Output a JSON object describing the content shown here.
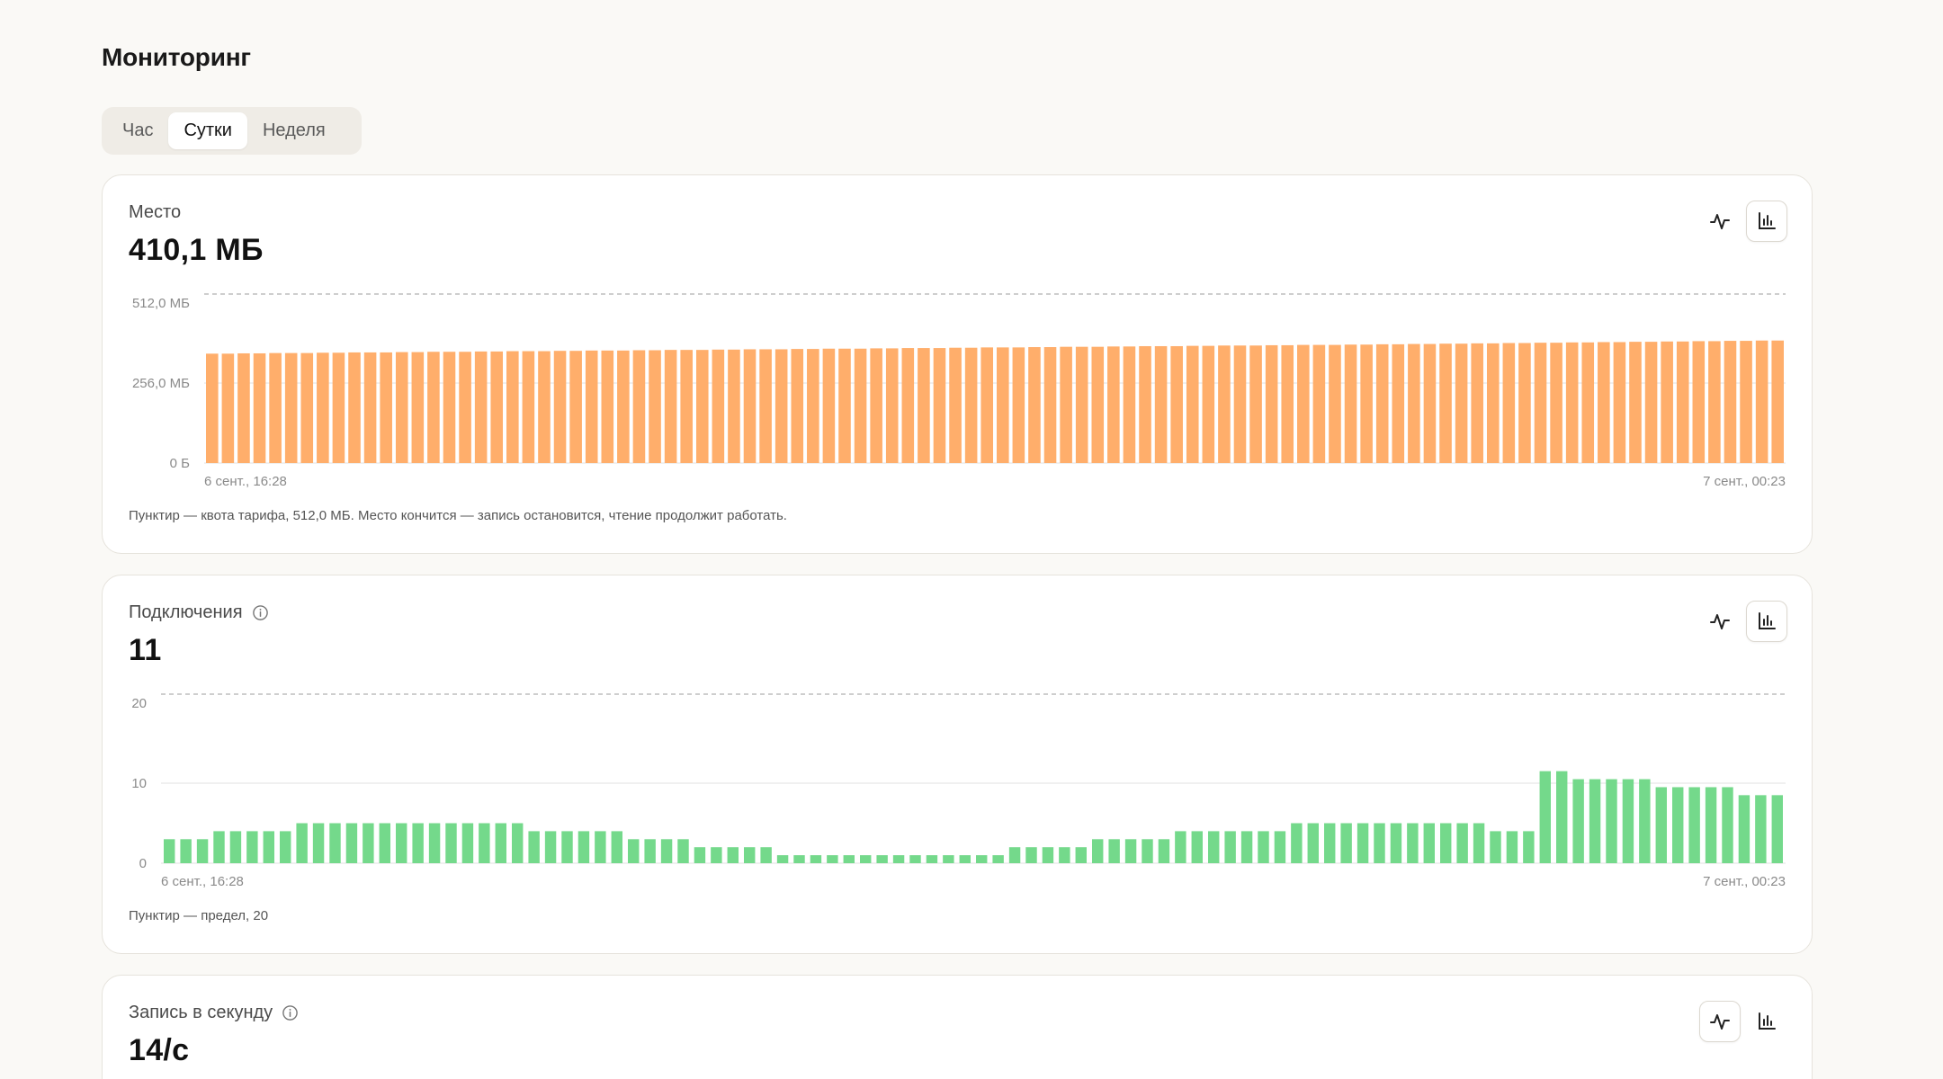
{
  "page": {
    "title": "Мониторинг",
    "periods": [
      "Час",
      "Сутки",
      "Неделя"
    ],
    "active_period": "Сутки"
  },
  "icons": {
    "line_chart": "line-chart-icon",
    "bar_chart": "bar-chart-icon",
    "info": "info-icon"
  },
  "colors": {
    "storage_bar": "#ffae6b",
    "connections_bar": "#74d98b",
    "quota_line": "#bdbdbd"
  },
  "cards": {
    "storage": {
      "label": "Место",
      "value": "410,1 МБ",
      "note": "Пунктир — квота тарифа, 512,0 МБ. Место кончится — запись остановится, чтение продолжит работать.",
      "active_view": "bar"
    },
    "connections": {
      "label": "Подключения",
      "value": "11",
      "note": "Пунктир — предел, 20",
      "active_view": "bar"
    },
    "writes": {
      "label": "Запись в секунду",
      "value": "14/с",
      "active_view": "line"
    }
  },
  "chart_data": [
    {
      "type": "bar",
      "name": "storage",
      "y_ticks": [
        "512,0 МБ",
        "256,0 МБ",
        "0 Б"
      ],
      "x_start_label": "6 сент., 16:28",
      "x_end_label": "7 сент., 00:23",
      "ylim": [
        0,
        512
      ],
      "quota": 512,
      "grid": true,
      "values": [
        350,
        350,
        351,
        351,
        352,
        352,
        352,
        353,
        353,
        354,
        354,
        354,
        355,
        355,
        356,
        356,
        356,
        357,
        357,
        358,
        358,
        358,
        359,
        359,
        360,
        360,
        360,
        361,
        361,
        362,
        362,
        362,
        363,
        363,
        364,
        364,
        364,
        365,
        365,
        366,
        366,
        366,
        367,
        367,
        368,
        368,
        368,
        369,
        369,
        370,
        370,
        370,
        371,
        371,
        372,
        372,
        372,
        373,
        373,
        374,
        374,
        374,
        375,
        375,
        376,
        376,
        376,
        377,
        377,
        378,
        378,
        378,
        379,
        379,
        380,
        380,
        381,
        381,
        382,
        382,
        383,
        383,
        384,
        384,
        385,
        385,
        386,
        386,
        387,
        387,
        388,
        388,
        389,
        389,
        390,
        390,
        391,
        391,
        392,
        392
      ]
    },
    {
      "type": "bar",
      "name": "connections",
      "y_ticks": [
        "20",
        "10",
        "0"
      ],
      "x_start_label": "6 сент., 16:28",
      "x_end_label": "7 сент., 00:23",
      "ylim": [
        0,
        20
      ],
      "quota": 20,
      "grid": true,
      "values": [
        3,
        3,
        3,
        4,
        4,
        4,
        4,
        4,
        5,
        5,
        5,
        5,
        5,
        5,
        5,
        5,
        5,
        5,
        5,
        5,
        5,
        5,
        4,
        4,
        4,
        4,
        4,
        4,
        3,
        3,
        3,
        3,
        2,
        2,
        2,
        2,
        2,
        1,
        1,
        1,
        1,
        1,
        1,
        1,
        1,
        1,
        1,
        1,
        1,
        1,
        1,
        2,
        2,
        2,
        2,
        2,
        3,
        3,
        3,
        3,
        3,
        4,
        4,
        4,
        4,
        4,
        4,
        4,
        5,
        5,
        5,
        5,
        5,
        5,
        5,
        5,
        5,
        5,
        5,
        5,
        4,
        4,
        4,
        11.5,
        11.5,
        10.5,
        10.5,
        10.5,
        10.5,
        10.5,
        9.5,
        9.5,
        9.5,
        9.5,
        9.5,
        8.5,
        8.5,
        8.5
      ]
    }
  ]
}
